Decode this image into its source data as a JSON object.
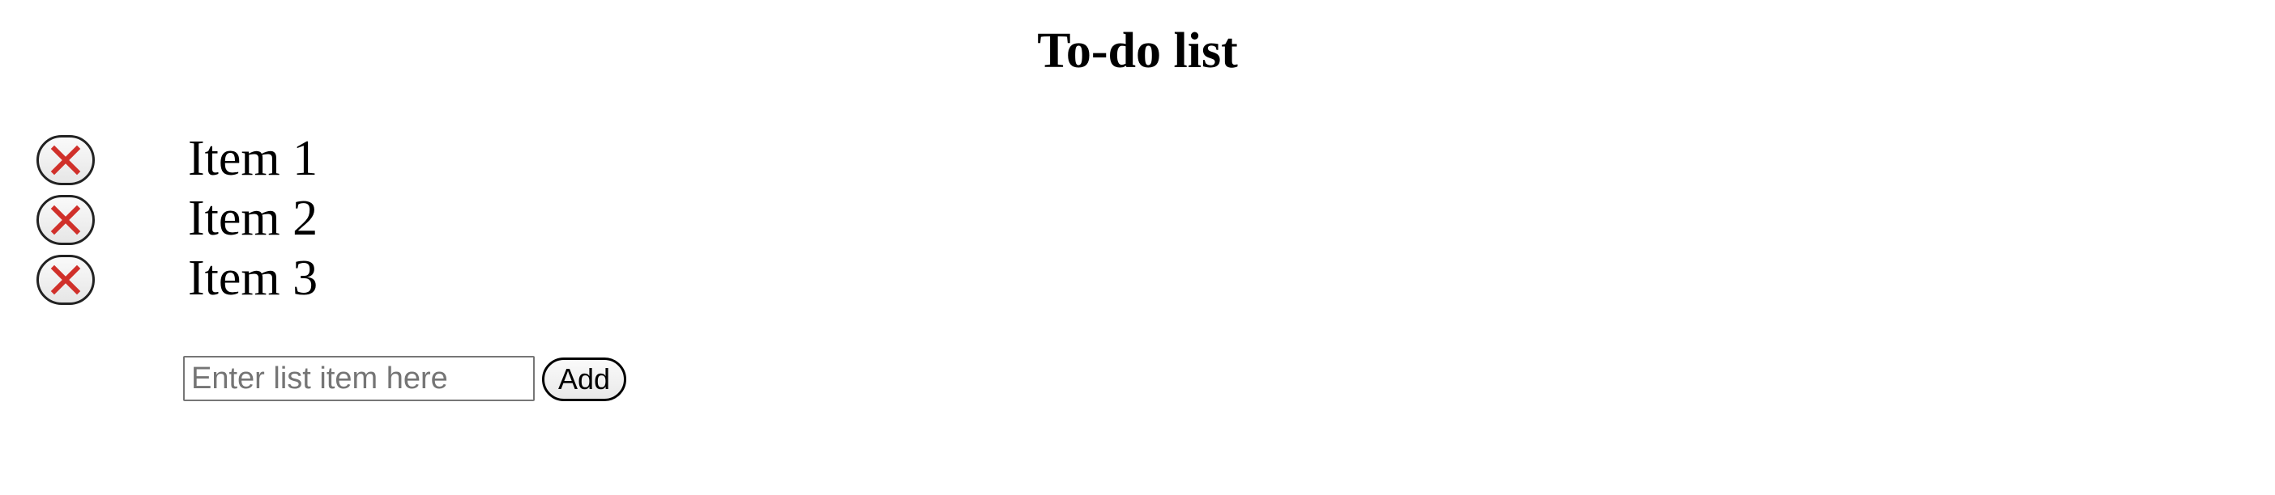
{
  "page": {
    "title": "To-do list"
  },
  "list": {
    "items": [
      {
        "label": "Item 1",
        "remove_icon": "close-icon"
      },
      {
        "label": "Item 2",
        "remove_icon": "close-icon"
      },
      {
        "label": "Item 3",
        "remove_icon": "close-icon"
      }
    ]
  },
  "form": {
    "input_value": "",
    "input_placeholder": "Enter list item here",
    "add_label": "Add"
  },
  "colors": {
    "remove_icon": "#d0302a",
    "text": "#000000",
    "background": "#ffffff"
  }
}
